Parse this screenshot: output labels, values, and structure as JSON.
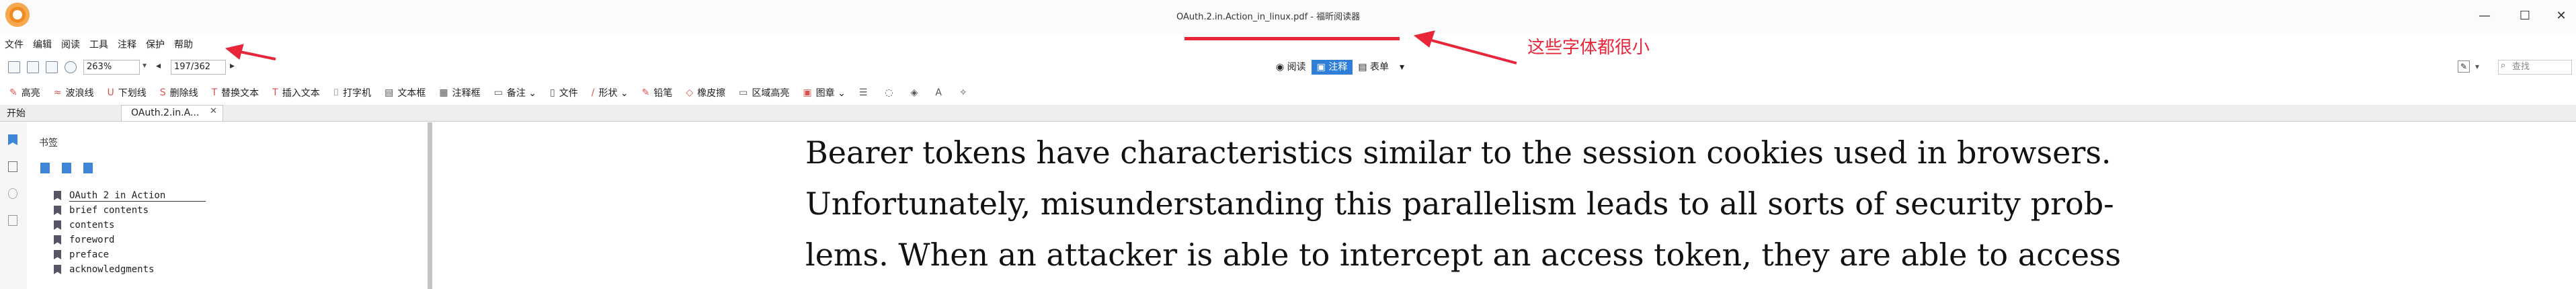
{
  "window": {
    "title": "OAuth.2.in.Action_in_linux.pdf - 福昕阅读器",
    "controls": {
      "minimize": "—",
      "maximize": "☐",
      "close": "✕"
    }
  },
  "menu": [
    "文件",
    "编辑",
    "阅读",
    "工具",
    "注释",
    "保护",
    "帮助"
  ],
  "toolbar1": {
    "zoom": "263%",
    "page": "197/362",
    "modes": [
      {
        "label": "阅读",
        "active": false
      },
      {
        "label": "注释",
        "active": true
      },
      {
        "label": "表单",
        "active": false
      }
    ],
    "search_placeholder": "查找"
  },
  "toolbar2": [
    {
      "glyph": "✎",
      "label": "高亮",
      "icon": "highlight-icon"
    },
    {
      "glyph": "≈",
      "label": "波浪线",
      "icon": "squiggly-icon"
    },
    {
      "glyph": "U",
      "label": "下划线",
      "icon": "underline-icon"
    },
    {
      "glyph": "S",
      "label": "删除线",
      "icon": "strikeout-icon"
    },
    {
      "glyph": "T",
      "label": "替换文本",
      "icon": "replace-text-icon"
    },
    {
      "glyph": "T",
      "label": "插入文本",
      "icon": "insert-text-icon"
    },
    {
      "glyph": "⌷",
      "label": "打字机",
      "icon": "typewriter-icon"
    },
    {
      "glyph": "▤",
      "label": "文本框",
      "icon": "textbox-icon"
    },
    {
      "glyph": "▦",
      "label": "注释框",
      "icon": "callout-icon"
    },
    {
      "glyph": "▭",
      "label": "备注 ⌄",
      "icon": "note-icon"
    },
    {
      "glyph": "▯",
      "label": "文件",
      "icon": "file-attach-icon"
    },
    {
      "glyph": "/",
      "label": "形状 ⌄",
      "icon": "shape-icon"
    },
    {
      "glyph": "✎",
      "label": "铅笔",
      "icon": "pencil-icon"
    },
    {
      "glyph": "◇",
      "label": "橡皮擦",
      "icon": "eraser-icon"
    },
    {
      "glyph": "▭",
      "label": "区域高亮",
      "icon": "area-highlight-icon"
    },
    {
      "glyph": "▣",
      "label": "图章 ⌄",
      "icon": "stamp-icon"
    }
  ],
  "tabs": {
    "home": "开始",
    "document": "OAuth.2.in.A..."
  },
  "sidebar": {
    "title": "书签",
    "bookmarks": [
      "OAuth 2 in Action",
      "brief contents",
      "contents",
      "foreword",
      "preface",
      "acknowledgments"
    ]
  },
  "annotation": {
    "text": "这些字体都很小",
    "color": "#e8263a"
  },
  "document": {
    "lines": [
      "Bearer tokens have characteristics similar to the session cookies used in browsers.",
      "Unfortunately, misunderstanding this parallelism leads to all sorts of security prob-",
      "lems. When an attacker is able to intercept an access token, they are able to access"
    ]
  },
  "colors": {
    "accent": "#2f7fd8",
    "annotation_red": "#e8263a",
    "logo": "#f08a24"
  }
}
